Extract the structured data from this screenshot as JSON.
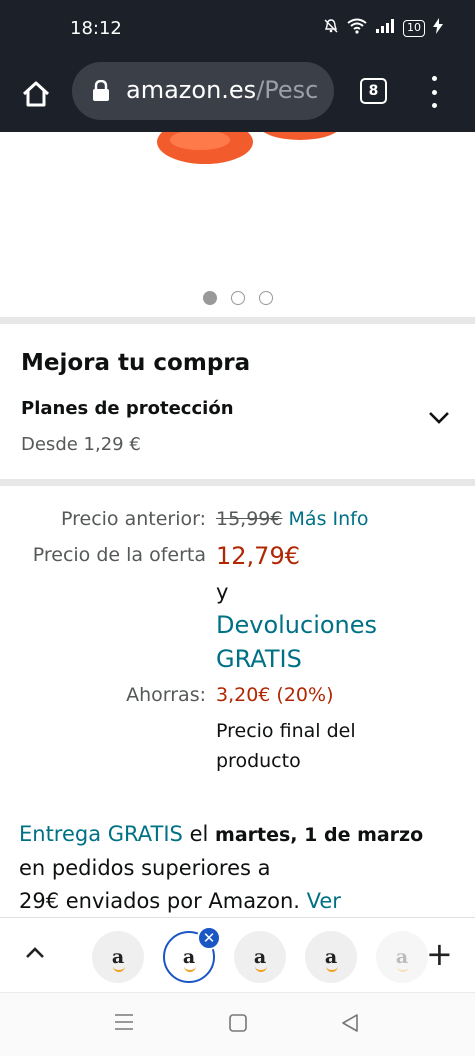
{
  "status_bar": {
    "time": "18:12",
    "battery": "10"
  },
  "browser": {
    "url_host": "amazon.es",
    "url_path": "/Pesc",
    "tab_count": "8"
  },
  "carousel": {
    "dots": 3,
    "active_index": 0
  },
  "mejora": {
    "title": "Mejora tu compra",
    "plans_label": "Planes de protección",
    "plans_price": "Desde 1,29 €"
  },
  "pricing": {
    "previous_label": "Precio anterior:",
    "previous_value": "15,99€",
    "more_info": "Más Info",
    "offer_label": "Precio de la oferta",
    "offer_value": "12,79€",
    "and_text": "y",
    "returns_line1": "Devoluciones",
    "returns_line2": "GRATIS",
    "savings_label": "Ahorras:",
    "savings_value": "3,20€ (20%)",
    "final_line1": "Precio final del",
    "final_line2": "producto"
  },
  "delivery": {
    "free_delivery": "Entrega GRATIS",
    "the": "el",
    "date": "martes, 1 de marzo",
    "line2": "en pedidos superiores a",
    "line3": "29€ enviados por Amazon.",
    "see": "Ver"
  },
  "tab_strip": {
    "tab_letter": "a",
    "close_symbol": "✕",
    "add_symbol": "+"
  },
  "colors": {
    "link": "#007185",
    "price_red": "#b12704",
    "tab_selected": "#1a56c4",
    "browser_bg": "#1b2029"
  }
}
